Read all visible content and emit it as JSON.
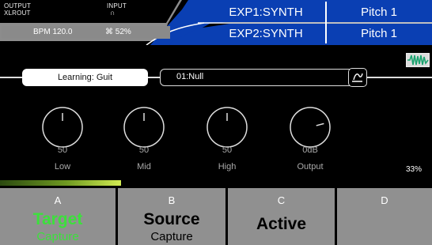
{
  "header": {
    "output_label": "OUTPUT",
    "output_value": "XLROUT",
    "input_label": "INPUT",
    "input_icon": "headphones-icon",
    "input_glyph": "∩",
    "bpm": "BPM 120.0",
    "cpu_icon": "cpu-icon",
    "cpu_glyph": "⌘",
    "cpu": "52%",
    "exp1_name": "EXP1:SYNTH",
    "exp1_param": "Pitch 1",
    "exp2_name": "EXP2:SYNTH",
    "exp2_param": "Pitch 1"
  },
  "learning": {
    "label": "Learning: Guit",
    "preset": "01:Null",
    "wave_icon": "waveform-icon",
    "preset_button_icon": "edit-icon"
  },
  "knobs": [
    {
      "label": "Low",
      "value": "50",
      "level": 0.5
    },
    {
      "label": "Mid",
      "value": "50",
      "level": 0.5
    },
    {
      "label": "High",
      "value": "50",
      "level": 0.5
    },
    {
      "label": "Output",
      "value": "0dB",
      "level": 0.75
    }
  ],
  "percent": "33%",
  "meter_level": 0.78,
  "softkeys": [
    {
      "letter": "A",
      "main": "Target",
      "sub": "Capture"
    },
    {
      "letter": "B",
      "main": "Source",
      "sub": "Capture"
    },
    {
      "letter": "C",
      "main": "Active",
      "sub": ""
    },
    {
      "letter": "D",
      "main": "",
      "sub": ""
    }
  ],
  "colors": {
    "accent_blue": "#0a3fb3",
    "active_green": "#3ce03c",
    "softkey_gray": "#909090",
    "meter_green": "#d2ec52"
  }
}
